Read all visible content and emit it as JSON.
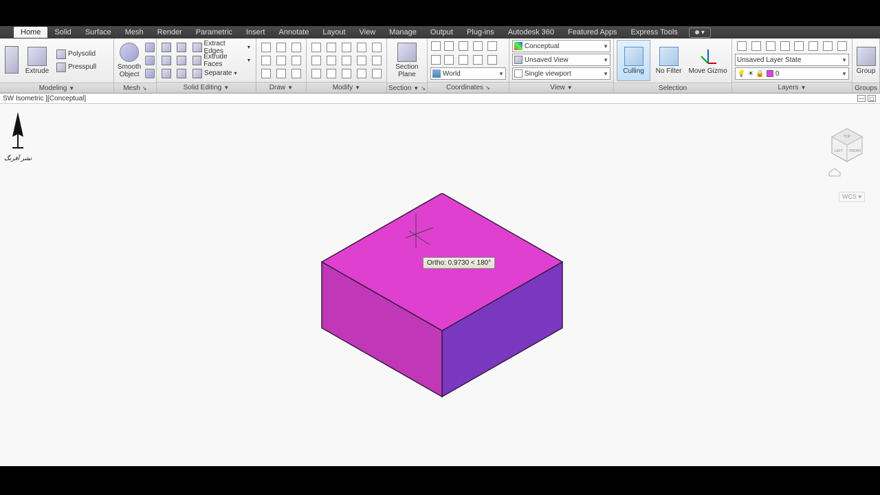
{
  "menu": {
    "tabs": [
      "Home",
      "Solid",
      "Surface",
      "Mesh",
      "Render",
      "Parametric",
      "Insert",
      "Annotate",
      "Layout",
      "View",
      "Manage",
      "Output",
      "Plug-ins",
      "Autodesk 360",
      "Featured Apps",
      "Express Tools"
    ],
    "active": "Home"
  },
  "ribbon": {
    "modeling": {
      "title": "Modeling",
      "polysolid": "Polysolid",
      "extrude": "Extrude",
      "presspull": "Presspull",
      "smooth": "Smooth Object"
    },
    "mesh": {
      "title": "Mesh"
    },
    "solid_editing": {
      "title": "Solid Editing",
      "extract_edges": "Extract Edges",
      "extrude_faces": "Extrude Faces",
      "separate": "Separate"
    },
    "draw": {
      "title": "Draw"
    },
    "modify": {
      "title": "Modify"
    },
    "section": {
      "title": "Section",
      "section_plane": "Section Plane"
    },
    "coordinates": {
      "title": "Coordinates",
      "world": "World"
    },
    "view": {
      "title": "View",
      "visual_style": "Conceptual",
      "saved_view": "Unsaved View",
      "viewport": "Single viewport"
    },
    "selection": {
      "title": "Selection",
      "culling": "Culling",
      "no_filter": "No Filter",
      "move_gizmo": "Move Gizmo"
    },
    "layers": {
      "title": "Layers",
      "layer_state": "Unsaved Layer State",
      "layer_name": "0"
    },
    "groups": {
      "title": "Groups",
      "group": "Group"
    }
  },
  "viewport": {
    "label": "SW Isometric ][Conceptual]"
  },
  "tooltip": {
    "text": "Ortho: 0.9730 < 180°"
  },
  "wcs": {
    "label": "WCS"
  }
}
